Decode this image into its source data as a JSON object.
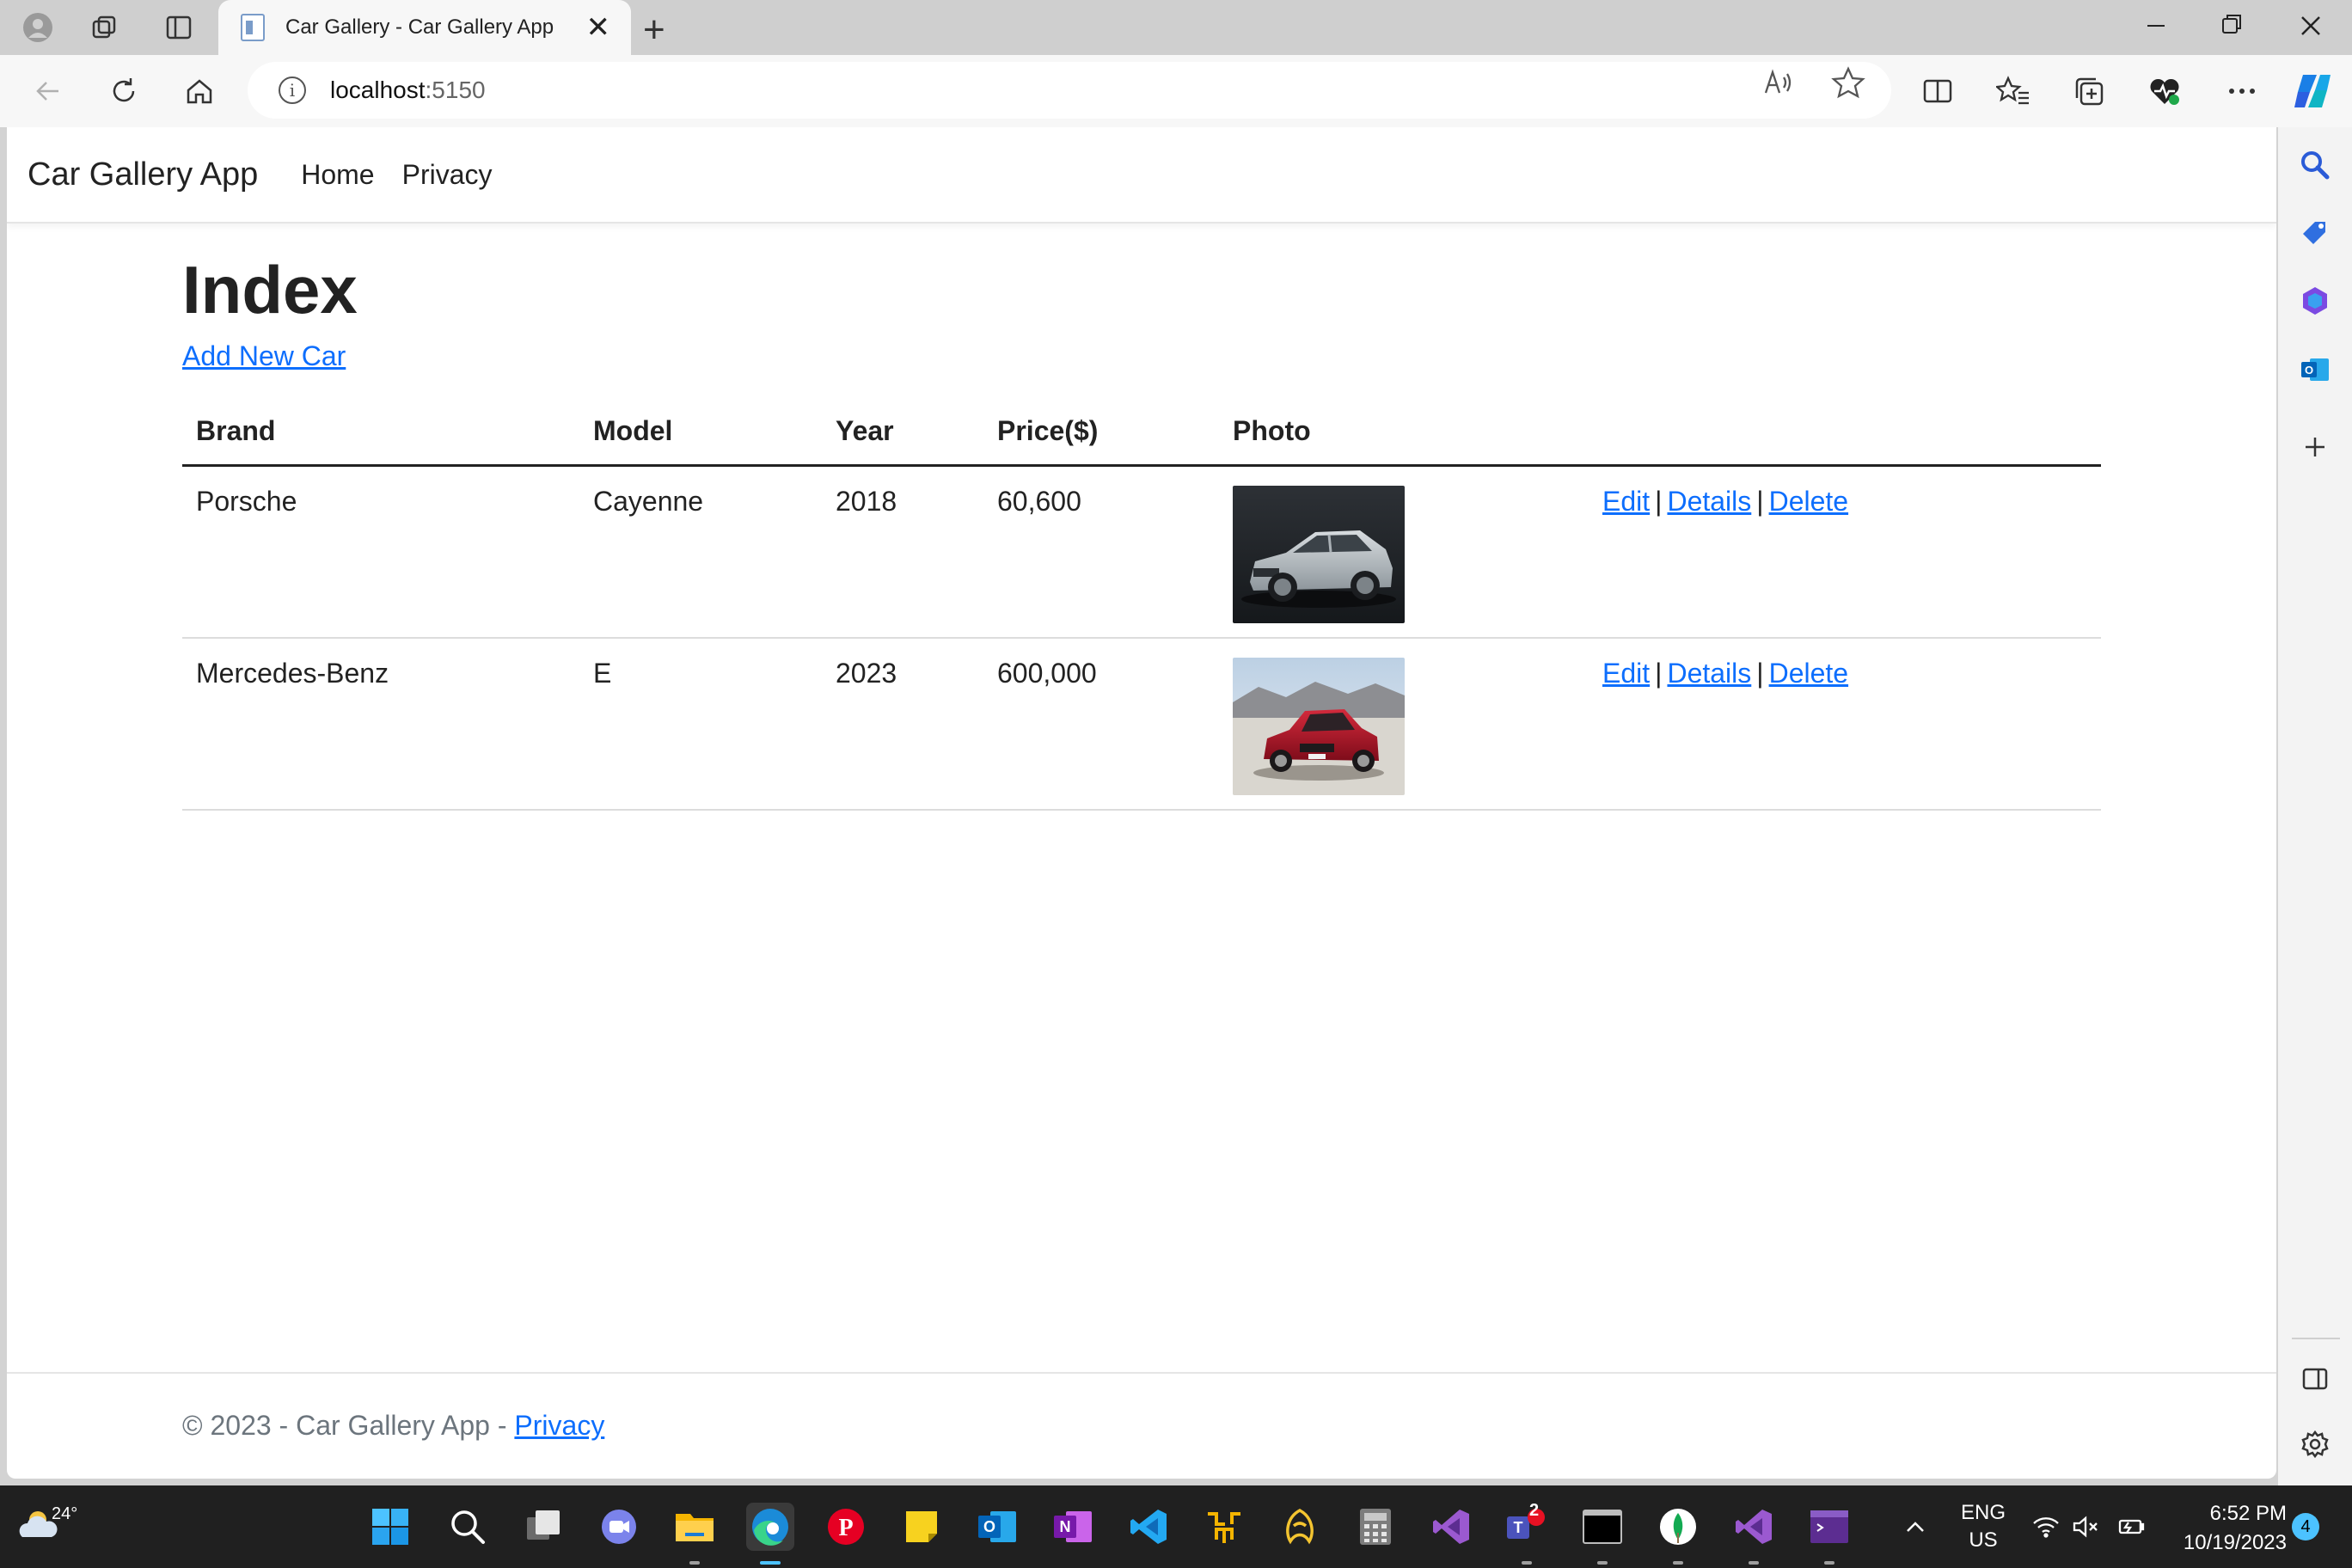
{
  "browser": {
    "tab_title": "Car Gallery - Car Gallery App",
    "tab_close": "✕",
    "new_tab": "+",
    "url_host": "localhost",
    "url_port": ":5150"
  },
  "app": {
    "brand": "Car Gallery App",
    "nav": [
      "Home",
      "Privacy"
    ]
  },
  "page": {
    "title": "Index",
    "create_link": "Add New Car",
    "table": {
      "headers": [
        "Brand",
        "Model",
        "Year",
        "Price($)",
        "Photo",
        ""
      ],
      "rows": [
        {
          "brand": "Porsche",
          "model": "Cayenne",
          "year": "2018",
          "price": "60,600",
          "photo": "silver-porsche-cayenne",
          "actions": [
            "Edit",
            "Details",
            "Delete"
          ]
        },
        {
          "brand": "Mercedes-Benz",
          "model": "E",
          "year": "2023",
          "price": "600,000",
          "photo": "red-mercedes-e-class",
          "actions": [
            "Edit",
            "Details",
            "Delete"
          ]
        }
      ],
      "separator": "|"
    }
  },
  "footer": {
    "text": "© 2023 - Car Gallery App - ",
    "link": "Privacy"
  },
  "taskbar": {
    "weather_temp": "24°",
    "lang_top": "ENG",
    "lang_bottom": "US",
    "time": "6:52 PM",
    "date": "10/19/2023",
    "notifications": "4",
    "teams_badge": "2"
  },
  "colors": {
    "link": "#0d6efd",
    "taskbar": "#202020",
    "accent": "#4cc2ff"
  }
}
